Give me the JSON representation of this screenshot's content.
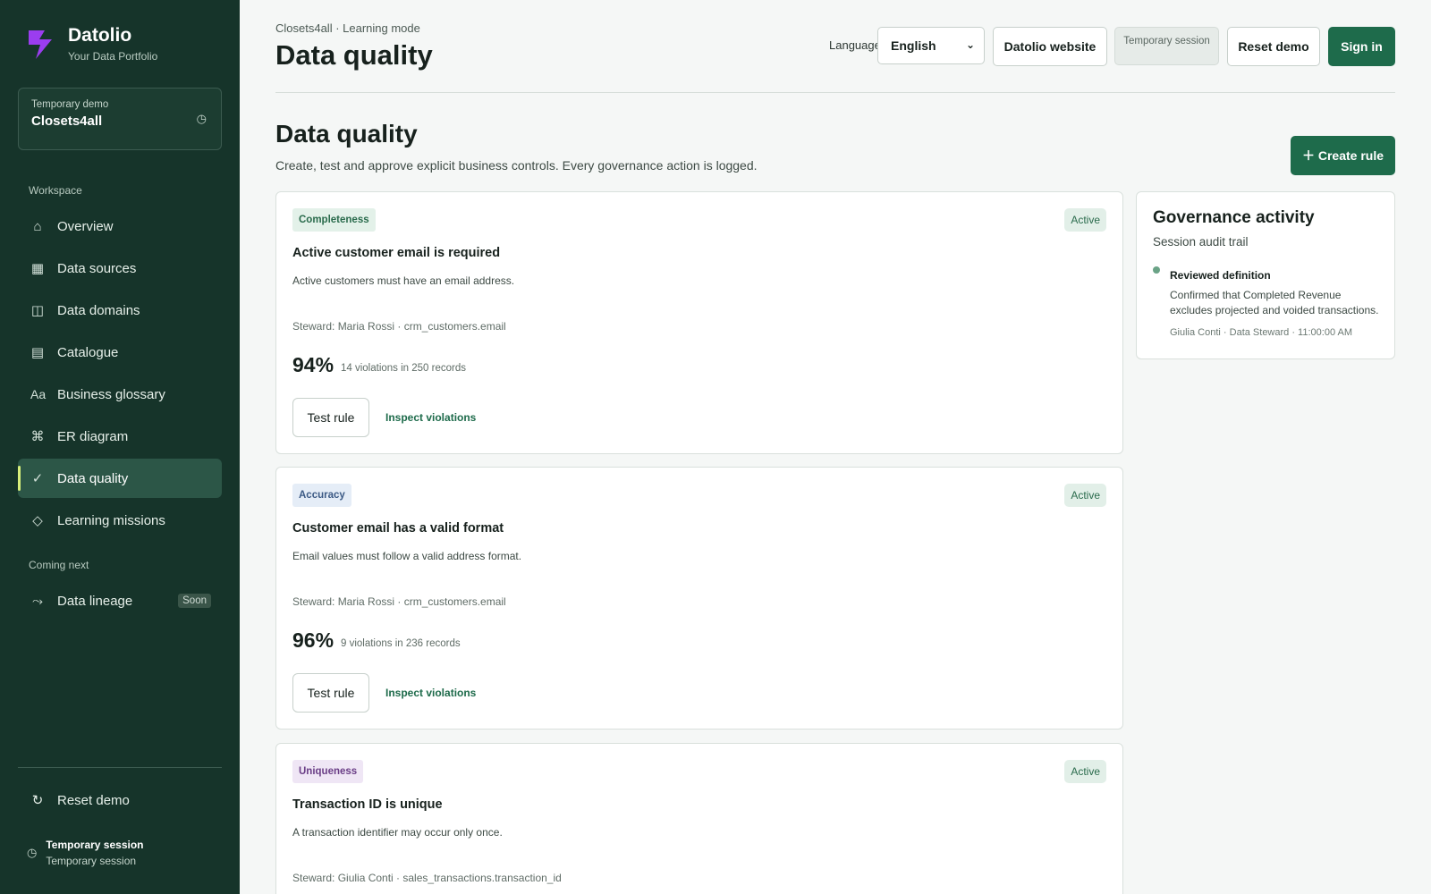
{
  "brand": {
    "name": "Datolio",
    "tagline": "Your Data Portfolio"
  },
  "demo_card": {
    "label": "Temporary demo",
    "value": "Closets4all",
    "icon": "clock-icon"
  },
  "sidebar": {
    "workspace_label": "Workspace",
    "items": [
      {
        "label": "Overview",
        "icon": "home-icon",
        "glyph": "⌂"
      },
      {
        "label": "Data sources",
        "icon": "grid-icon",
        "glyph": "▦"
      },
      {
        "label": "Data domains",
        "icon": "domains-icon",
        "glyph": "◫"
      },
      {
        "label": "Catalogue",
        "icon": "list-icon",
        "glyph": "▤"
      },
      {
        "label": "Business glossary",
        "icon": "glossary-icon",
        "glyph": "Aa"
      },
      {
        "label": "ER diagram",
        "icon": "diagram-icon",
        "glyph": "⌘"
      },
      {
        "label": "Data quality",
        "icon": "check-icon",
        "glyph": "✓",
        "active": true
      },
      {
        "label": "Learning missions",
        "icon": "diamond-icon",
        "glyph": "◇"
      }
    ],
    "coming_next_label": "Coming next",
    "coming_items": [
      {
        "label": "Data lineage",
        "icon": "lineage-icon",
        "glyph": "⤳",
        "badge": "Soon"
      }
    ],
    "reset_label": "Reset demo",
    "session_title": "Temporary session",
    "session_sub": "Temporary session"
  },
  "header": {
    "breadcrumb": "Closets4all · Learning mode",
    "title": "Data quality",
    "language_label": "Language",
    "language_value": "English",
    "website_button": "Datolio website",
    "session_pill": "Temporary session",
    "reset_button": "Reset demo",
    "signin_button": "Sign in"
  },
  "section": {
    "title": "Data quality",
    "subtitle": "Create, test and approve explicit business controls. Every governance action is logged.",
    "create_button": "＋ Create rule"
  },
  "rules": [
    {
      "tag": "Completeness",
      "tag_bg": "#e3f1e9",
      "tag_fg": "#2a6b4c",
      "status": "Active",
      "title": "Active customer email is required",
      "description": "Active customers must have an email address.",
      "meta": "Steward: Maria Rossi · crm_customers.email",
      "score": "94%",
      "violations": "14 violations in 250 records",
      "test_label": "Test rule",
      "inspect_label": "Inspect violations"
    },
    {
      "tag": "Accuracy",
      "tag_bg": "#e5edf7",
      "tag_fg": "#3c5a85",
      "status": "Active",
      "title": "Customer email has a valid format",
      "description": "Email values must follow a valid address format.",
      "meta": "Steward: Maria Rossi · crm_customers.email",
      "score": "96%",
      "violations": "9 violations in 236 records",
      "test_label": "Test rule",
      "inspect_label": "Inspect violations"
    },
    {
      "tag": "Uniqueness",
      "tag_bg": "#efe6f5",
      "tag_fg": "#6a3e86",
      "status": "Active",
      "title": "Transaction ID is unique",
      "description": "A transaction identifier may occur only once.",
      "meta": "Steward: Giulia Conti · sales_transactions.transaction_id"
    }
  ],
  "governance": {
    "title": "Governance activity",
    "subtitle": "Session audit trail",
    "events": [
      {
        "title": "Reviewed definition",
        "body": "Confirmed that Completed Revenue excludes projected and voided transactions.",
        "meta": "Giulia Conti · Data Steward · 11:00:00 AM"
      }
    ]
  },
  "colors": {
    "sidebar": "#16342a",
    "accent": "#1e6b4b",
    "active_marker": "#d8ef7a"
  }
}
